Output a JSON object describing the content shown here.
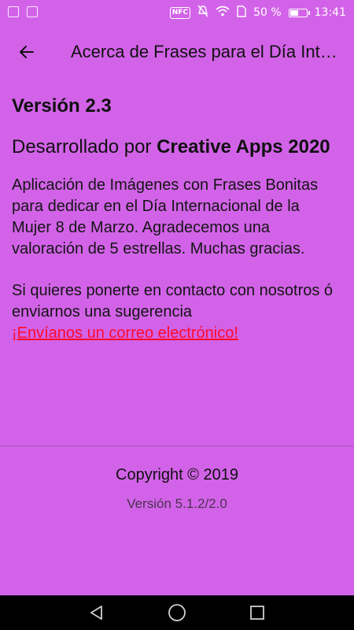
{
  "status_bar": {
    "battery_text": "50 %",
    "time": "13:41",
    "battery_level": 0.5
  },
  "toolbar": {
    "title": "Acerca de Frases para el Día Internacional de la Mujer",
    "back_icon": "arrow-left-icon"
  },
  "content": {
    "version": "Versión 2.3",
    "developer_prefix": "Desarrollado por ",
    "developer_name": "Creative Apps 2020",
    "description": "Aplicación de Imágenes con Frases Bonitas para dedicar en el Día Internacional de la Mujer 8 de Marzo. Agradecemos una valoración de 5 estrellas. Muchas gracias.",
    "contact_text": "Si quieres ponerte en contacto con nosotros ó enviarnos una sugerencia",
    "email_link": "¡Envíanos un correo electrónico!"
  },
  "footer": {
    "copyright": "Copyright © 2019",
    "version": "Versión 5.1.2/2.0"
  },
  "colors": {
    "background": "#d263e8",
    "link": "#ff0a2a",
    "nav_bar": "#000000"
  }
}
